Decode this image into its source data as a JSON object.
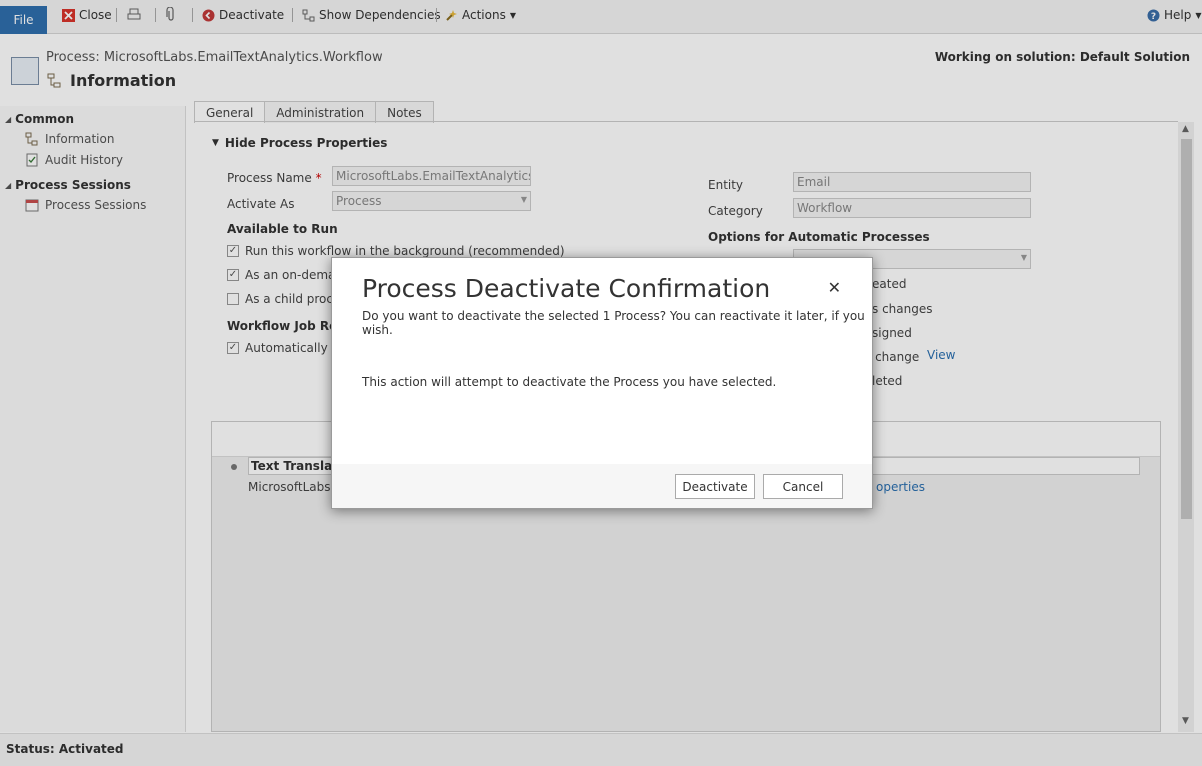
{
  "ribbon": {
    "file_label": "File",
    "close_label": "Close",
    "deactivate_label": "Deactivate",
    "show_dependencies_label": "Show Dependencies",
    "actions_label": "Actions",
    "help_label": "Help"
  },
  "header": {
    "subtitle": "Process: MicrosoftLabs.EmailTextAnalytics.Workflow",
    "title": "Information",
    "solution": "Working on solution: Default Solution"
  },
  "nav": {
    "groups": [
      {
        "label": "Common",
        "items": [
          {
            "label": "Information"
          },
          {
            "label": "Audit History"
          }
        ]
      },
      {
        "label": "Process Sessions",
        "items": [
          {
            "label": "Process Sessions"
          }
        ]
      }
    ]
  },
  "tabs": [
    {
      "label": "General"
    },
    {
      "label": "Administration"
    },
    {
      "label": "Notes"
    }
  ],
  "form": {
    "section_label": "Hide Process Properties",
    "process_name_label": "Process Name",
    "required_mark": "*",
    "process_name_value": "MicrosoftLabs.EmailTextAnalytics.Work",
    "activate_as_label": "Activate As",
    "activate_as_value": "Process",
    "available_to_run_label": "Available to Run",
    "check_background": "Run this workflow in the background (recommended)",
    "check_on_demand": "As an on-demand",
    "check_child": "As a child proces",
    "workflow_job_label": "Workflow Job Reten",
    "check_auto_delete": "Automatically del",
    "entity_label": "Entity",
    "entity_value": "Email",
    "category_label": "Category",
    "category_value": "Workflow",
    "options_label": "Options for Automatic Processes",
    "opt_1": "eated",
    "opt_2": "s changes",
    "opt_3": "signed",
    "opt_4": "s change",
    "opt_4_link": "View",
    "opt_5": "leted",
    "step_name": "Text Translation",
    "step_sub": "MicrosoftLabs.E",
    "step_link": "operties"
  },
  "status": {
    "text": "Status: Activated"
  },
  "dialog": {
    "title": "Process Deactivate Confirmation",
    "subtitle": "Do you want to deactivate the selected 1 Process? You can reactivate it later, if you wish.",
    "body": "This action will attempt to deactivate the Process you have selected.",
    "deactivate_button": "Deactivate",
    "cancel_button": "Cancel",
    "close_glyph": "✕"
  },
  "colors": {
    "accent": "#2f6fae",
    "link": "#2a6fb0",
    "required": "#cc0000"
  }
}
